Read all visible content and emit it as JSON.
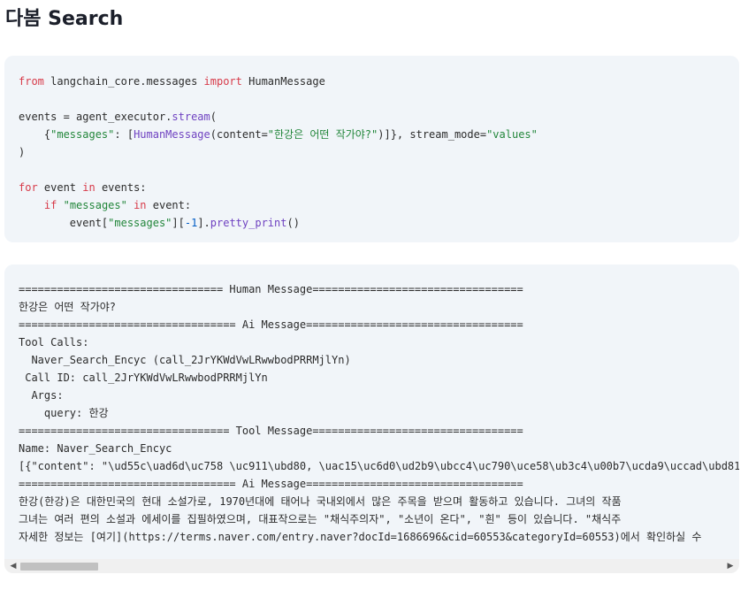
{
  "page": {
    "title": "다봄 Search"
  },
  "code_input": {
    "lines": [
      [
        [
          "kw",
          "from"
        ],
        [
          "p",
          " langchain_core.messages "
        ],
        [
          "kw",
          "import"
        ],
        [
          "p",
          " HumanMessage"
        ]
      ],
      [],
      [
        [
          "p",
          "events = agent_executor."
        ],
        [
          "fn",
          "stream"
        ],
        [
          "p",
          "("
        ]
      ],
      [
        [
          "p",
          "    {"
        ],
        [
          "str",
          "\"messages\""
        ],
        [
          "p",
          ": ["
        ],
        [
          "cls",
          "HumanMessage"
        ],
        [
          "p",
          "(content="
        ],
        [
          "str",
          "\"한강은 어떤 작가야?\""
        ],
        [
          "p",
          ")]}, stream_mode="
        ],
        [
          "str",
          "\"values\""
        ]
      ],
      [
        [
          "p",
          ")"
        ]
      ],
      [],
      [
        [
          "kw",
          "for"
        ],
        [
          "p",
          " event "
        ],
        [
          "kw",
          "in"
        ],
        [
          "p",
          " events:"
        ]
      ],
      [
        [
          "p",
          "    "
        ],
        [
          "kw",
          "if"
        ],
        [
          "p",
          " "
        ],
        [
          "str",
          "\"messages\""
        ],
        [
          "p",
          " "
        ],
        [
          "kw",
          "in"
        ],
        [
          "p",
          " event:"
        ]
      ],
      [
        [
          "p",
          "        event["
        ],
        [
          "str",
          "\"messages\""
        ],
        [
          "p",
          "]["
        ],
        [
          "num",
          "-1"
        ],
        [
          "p",
          "]."
        ],
        [
          "fn",
          "pretty_print"
        ],
        [
          "p",
          "()"
        ]
      ]
    ]
  },
  "code_output": {
    "lines": [
      "================================ Human Message=================================",
      "한강은 어떤 작가야?",
      "================================== Ai Message==================================",
      "Tool Calls:",
      "  Naver_Search_Encyc (call_2JrYKWdVwLRwwbodPRRMjlYn)",
      " Call ID: call_2JrYKWdVwLRwwbodPRRMjlYn",
      "  Args:",
      "    query: 한강",
      "================================= Tool Message=================================",
      "Name: Naver_Search_Encyc",
      "[{\"content\": \"\\ud55c\\uad6d\\uc758 \\uc911\\ubd80, \\uac15\\uc6d0\\ud2b9\\ubcc4\\uc790\\uce58\\ub3c4\\u00b7\\ucda9\\uccad\\ubd81\\uc",
      "================================== Ai Message==================================",
      "한강(한강)은 대한민국의 현대 소설가로, 1970년대에 태어나 국내외에서 많은 주목을 받으며 활동하고 있습니다. 그녀의 작품",
      "그녀는 여러 편의 소설과 에세이를 집필하였으며, 대표작으로는 \"채식주의자\", \"소년이 온다\", \"흰\" 등이 있습니다. \"채식주",
      "자세한 정보는 [여기](https://terms.naver.com/entry.naver?docId=1686696&cid=60553&categoryId=60553)에서 확인하실 수"
    ]
  },
  "scrollbar": {
    "left_arrow": "◀",
    "right_arrow": "▶",
    "position": 0.0
  }
}
